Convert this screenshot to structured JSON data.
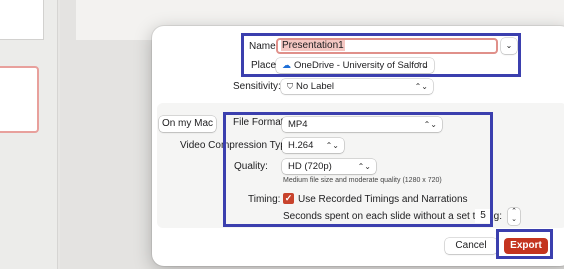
{
  "dialog": {
    "name_label": "Name:",
    "name_value": "Presentation1",
    "expand_glyph": "⌄",
    "place_label": "Place:",
    "place_value": "OneDrive - University of Salford",
    "place_icon": "cloud-icon",
    "sensitivity_label": "Sensitivity:",
    "sensitivity_value": "No Label",
    "sensitivity_icon": "shield-icon",
    "on_my_mac": "On my Mac",
    "file_format_label": "File Format:",
    "file_format_value": "MP4",
    "compression_label": "Video Compression Type:",
    "compression_value": "H.264",
    "quality_label": "Quality:",
    "quality_value": "HD (720p)",
    "quality_hint": "Medium file size and moderate quality (1280 x 720)",
    "timing_label": "Timing:",
    "timing_checkbox_label": "Use Recorded Timings and Narrations",
    "timing_checked": true,
    "seconds_label": "Seconds spent on each slide without a set timing:",
    "seconds_value": "5",
    "cancel": "Cancel",
    "export": "Export"
  },
  "colors": {
    "accent": "#c4341f",
    "annotation": "#3b3fae"
  },
  "glyphs": {
    "updown": "⌃⌄",
    "check": "✓",
    "cloud": "☁",
    "shield": "⛉"
  }
}
